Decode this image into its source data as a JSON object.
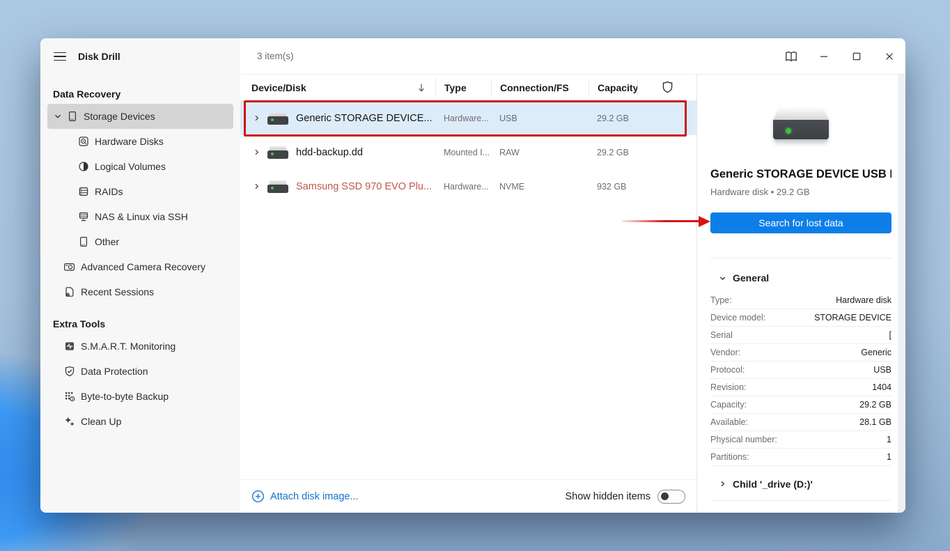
{
  "app": {
    "title": "Disk Drill"
  },
  "titlebar": {
    "status": "3 item(s)"
  },
  "icons": {
    "menu": "hamburger",
    "help": "open-book",
    "minimize": "minus",
    "maximize": "square",
    "close": "x",
    "sort": "arrow-down",
    "safe_column": "shield-outline",
    "attach": "plus-circle",
    "expand": "chevron-right",
    "collapse": "chevron-down"
  },
  "sidebar": {
    "section1": "Data Recovery",
    "section2": "Extra Tools",
    "items": {
      "storage_devices": "Storage Devices",
      "hardware_disks": "Hardware Disks",
      "logical_volumes": "Logical Volumes",
      "raids": "RAIDs",
      "nas": "NAS & Linux via SSH",
      "other": "Other",
      "camera": "Advanced Camera Recovery",
      "recent": "Recent Sessions",
      "smart": "S.M.A.R.T. Monitoring",
      "protection": "Data Protection",
      "byte": "Byte-to-byte Backup",
      "cleanup": "Clean Up"
    }
  },
  "table": {
    "columns": {
      "device": "Device/Disk",
      "type": "Type",
      "connection": "Connection/FS",
      "capacity": "Capacity"
    },
    "rows": [
      {
        "name": "Generic STORAGE DEVICE...",
        "type": "Hardware...",
        "connection": "USB",
        "capacity": "29.2 GB",
        "selected": true
      },
      {
        "name": "hdd-backup.dd",
        "type": "Mounted I...",
        "connection": "RAW",
        "capacity": "29.2 GB",
        "selected": false
      },
      {
        "name": "Samsung SSD 970 EVO Plu...",
        "type": "Hardware...",
        "connection": "NVME",
        "capacity": "932 GB",
        "selected": false
      }
    ],
    "footer": {
      "attach": "Attach disk image...",
      "show_hidden": "Show hidden items",
      "toggle_state": "off"
    }
  },
  "details": {
    "title": "Generic STORAGE DEVICE USB De...",
    "subtitle": "Hardware disk • 29.2 GB",
    "search_button": "Search for lost data",
    "general_header": "General",
    "rows": [
      {
        "label": "Type:",
        "value": "Hardware disk"
      },
      {
        "label": "Device model:",
        "value": "STORAGE DEVICE"
      },
      {
        "label": "Serial",
        "value": "["
      },
      {
        "label": "Vendor:",
        "value": "Generic"
      },
      {
        "label": "Protocol:",
        "value": "USB"
      },
      {
        "label": "Revision:",
        "value": "1404"
      },
      {
        "label": "Capacity:",
        "value": "29.2 GB"
      },
      {
        "label": "Available:",
        "value": "28.1 GB"
      },
      {
        "label": "Physical number:",
        "value": "1"
      },
      {
        "label": "Partitions:",
        "value": "1"
      }
    ],
    "child_header": "Child '_drive (D:)'"
  },
  "colors": {
    "accent_blue": "#0d7ee8",
    "link_blue": "#1873cc",
    "selected_row_bg": "#ddecf9",
    "sidebar_selected_bg": "#d4d4d4",
    "warning_text_red": "#c1574f",
    "annotation_red": "#cc1414"
  }
}
